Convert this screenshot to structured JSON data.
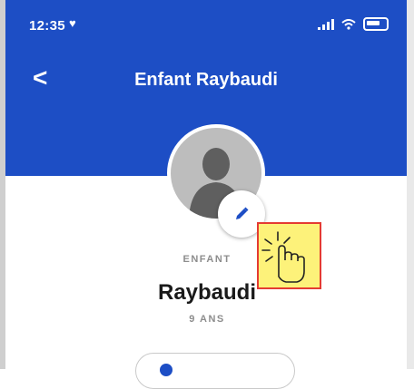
{
  "status_bar": {
    "time": "12:35",
    "notification_icon": "heart-icon",
    "icons": [
      "signal-icon",
      "wifi-icon",
      "battery-icon"
    ]
  },
  "header": {
    "back_icon": "chevron-left-icon",
    "back_glyph": "<",
    "title": "Enfant Raybaudi"
  },
  "profile": {
    "avatar_icon": "person-silhouette-icon",
    "edit_icon": "pencil-icon",
    "role": "ENFANT",
    "name": "Raybaudi",
    "age": "9 ANS"
  },
  "overlay": {
    "cursor_icon": "hand-pointer-click-icon"
  },
  "colors": {
    "primary": "#1d4ec5",
    "highlight_fill": "#fdf27a",
    "highlight_border": "#e43b32",
    "muted_text": "#8d8d8d"
  }
}
